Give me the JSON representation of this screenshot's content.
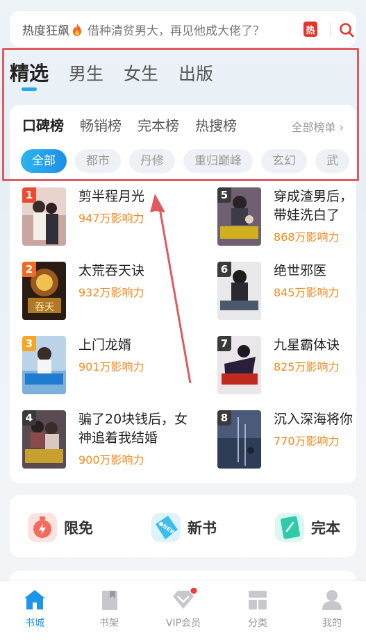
{
  "search": {
    "hot_label": "热度狂飙",
    "query": "借种清贫男大，再见他成大佬了？",
    "hot_badge": "热"
  },
  "channel_tabs": [
    "精选",
    "男生",
    "女生",
    "出版"
  ],
  "rank_tabs": [
    "口碑榜",
    "畅销榜",
    "完本榜",
    "热搜榜"
  ],
  "all_rank_link": "全部榜单 ›",
  "genre_chips": [
    "全部",
    "都市",
    "丹修",
    "重归巅峰",
    "玄幻",
    "武"
  ],
  "books": [
    {
      "rank": "1",
      "title": "剪半程月光",
      "impact": "947万影响力",
      "badge_color": "#f04a2d"
    },
    {
      "rank": "2",
      "title": "太荒吞天诀",
      "impact": "932万影响力",
      "badge_color": "#f06a28"
    },
    {
      "rank": "3",
      "title": "上门龙婿",
      "impact": "901万影响力",
      "badge_color": "#f5a623"
    },
    {
      "rank": "4",
      "title": "骗了20块钱后，女神追着我结婚",
      "impact": "900万影响力",
      "badge_color": "#3a3a3a"
    },
    {
      "rank": "5",
      "title": "穿成渣男后，带娃洗白了",
      "impact": "868万影响力",
      "badge_color": "#3a3a3a"
    },
    {
      "rank": "6",
      "title": "绝世邪医",
      "impact": "845万影响力",
      "badge_color": "#3a3a3a"
    },
    {
      "rank": "7",
      "title": "九星霸体诀",
      "impact": "825万影响力",
      "badge_color": "#3a3a3a"
    },
    {
      "rank": "8",
      "title": "沉入深海将你",
      "impact": "770万影响力",
      "badge_color": "#3a3a3a"
    }
  ],
  "features": [
    {
      "label": "限免",
      "icon": "stopwatch-icon"
    },
    {
      "label": "新书",
      "icon": "new-tag-icon"
    },
    {
      "label": "完本",
      "icon": "book-icon"
    }
  ],
  "bottom_nav": [
    {
      "label": "书城",
      "icon": "home-icon",
      "active": true
    },
    {
      "label": "书架",
      "icon": "bookshelf-icon",
      "active": false
    },
    {
      "label": "VIP会员",
      "icon": "vip-diamond-icon",
      "active": false
    },
    {
      "label": "分类",
      "icon": "category-icon",
      "active": false
    },
    {
      "label": "我的",
      "icon": "profile-icon",
      "active": false
    }
  ],
  "colors": {
    "accent_blue": "#1e96e8",
    "impact_orange": "#f08a1c",
    "highlight_red": "#e05a5f",
    "hot_red": "#e5342b"
  }
}
